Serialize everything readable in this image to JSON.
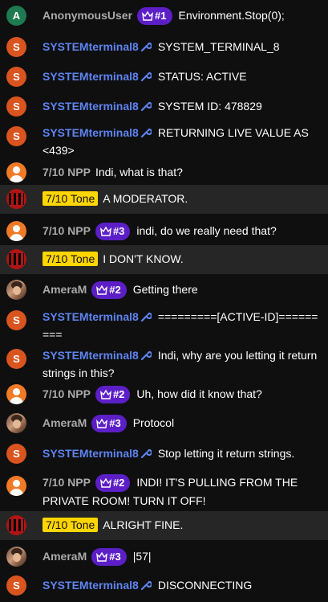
{
  "messages": [
    {
      "avatar": "A",
      "avatar_style": "letter-green",
      "author": "AnonymousUser",
      "author_style": "gray",
      "badge": "#1",
      "text": "Environment.Stop(0);"
    },
    {
      "avatar": "S",
      "avatar_style": "letter-orange",
      "author": "SYSTEMterminal8",
      "author_style": "moderator",
      "text": "SYSTEM_TERMINAL_8"
    },
    {
      "avatar": "S",
      "avatar_style": "letter-orange",
      "author": "SYSTEMterminal8",
      "author_style": "moderator",
      "text": "STATUS: ACTIVE"
    },
    {
      "avatar": "S",
      "avatar_style": "letter-orange",
      "author": "SYSTEMterminal8",
      "author_style": "moderator",
      "text": "SYSTEM ID: 478829"
    },
    {
      "avatar": "S",
      "avatar_style": "letter-orange",
      "author": "SYSTEMterminal8",
      "author_style": "moderator",
      "text": "RETURNING LIVE VALUE AS <439>"
    },
    {
      "avatar": "",
      "avatar_style": "person-icon",
      "author": "7/10 NPP",
      "author_style": "gray",
      "text": "Indi, what is that?"
    },
    {
      "avatar": "",
      "avatar_style": "stripes-icon",
      "author": "7/10 Tone",
      "author_style": "owner",
      "text": "A MODERATOR."
    },
    {
      "avatar": "",
      "avatar_style": "person-icon",
      "author": "7/10 NPP",
      "author_style": "gray",
      "badge": "#3",
      "text": "indi, do we really need that?"
    },
    {
      "avatar": "",
      "avatar_style": "stripes-icon",
      "author": "7/10 Tone",
      "author_style": "owner",
      "text": "I DON'T KNOW."
    },
    {
      "avatar": "",
      "avatar_style": "photo",
      "author": "AmeraM",
      "author_style": "gray",
      "badge": "#2",
      "text": "Getting there"
    },
    {
      "avatar": "S",
      "avatar_style": "letter-orange",
      "author": "SYSTEMterminal8",
      "author_style": "moderator",
      "text": "=========[ACTIVE-ID]========="
    },
    {
      "avatar": "S",
      "avatar_style": "letter-orange",
      "author": "SYSTEMterminal8",
      "author_style": "moderator",
      "text": "Indi, why are you letting it return strings in this?"
    },
    {
      "avatar": "",
      "avatar_style": "person-icon",
      "author": "7/10 NPP",
      "author_style": "gray",
      "badge": "#2",
      "text": "Uh, how did it know that?"
    },
    {
      "avatar": "",
      "avatar_style": "photo",
      "author": "AmeraM",
      "author_style": "gray",
      "badge": "#3",
      "text": "Protocol"
    },
    {
      "avatar": "S",
      "avatar_style": "letter-orange",
      "author": "SYSTEMterminal8",
      "author_style": "moderator",
      "text": "Stop letting it return strings."
    },
    {
      "avatar": "",
      "avatar_style": "person-icon",
      "author": "7/10 NPP",
      "author_style": "gray",
      "badge": "#2",
      "text": "INDI! IT'S PULLING FROM THE PRIVATE ROOM! TURN IT OFF!"
    },
    {
      "avatar": "",
      "avatar_style": "stripes-icon",
      "author": "7/10 Tone",
      "author_style": "owner",
      "text": "ALRIGHT FINE."
    },
    {
      "avatar": "",
      "avatar_style": "photo",
      "author": "AmeraM",
      "author_style": "gray",
      "badge": "#3",
      "text": "|57|"
    },
    {
      "avatar": "S",
      "avatar_style": "letter-orange",
      "author": "SYSTEMterminal8",
      "author_style": "moderator",
      "text": "DISCONNECTING"
    }
  ],
  "colors": {
    "background": "#0f0f0f",
    "highlight_row": "#262626",
    "moderator_name": "#5e84f1",
    "member_badge": "#5c1fc7",
    "owner_tag": "#ffd600"
  }
}
